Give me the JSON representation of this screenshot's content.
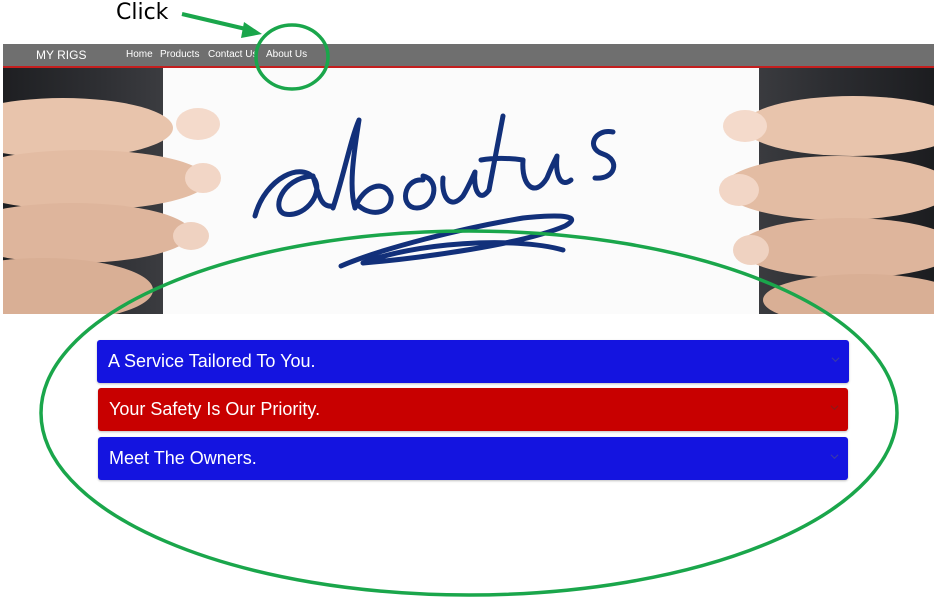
{
  "annotation": {
    "click_label": "Click",
    "highlight_color": "#1aa64b"
  },
  "navbar": {
    "brand": "MY RIGS",
    "links": [
      "Home",
      "Products",
      "Contact Us",
      "About Us"
    ],
    "background": "#6f6f6f",
    "accent": "#c41e1e"
  },
  "hero": {
    "image": "about-us-handwritten-card-held-by-hands"
  },
  "accordion": {
    "items": [
      {
        "label": "A Service Tailored To You.",
        "color": "#1414e0",
        "icon": "chevron-down-icon"
      },
      {
        "label": "Your Safety Is Our Priority.",
        "color": "#c80000",
        "icon": "chevron-down-icon"
      },
      {
        "label": "Meet The Owners.",
        "color": "#1414e0",
        "icon": "chevron-down-icon"
      }
    ]
  }
}
